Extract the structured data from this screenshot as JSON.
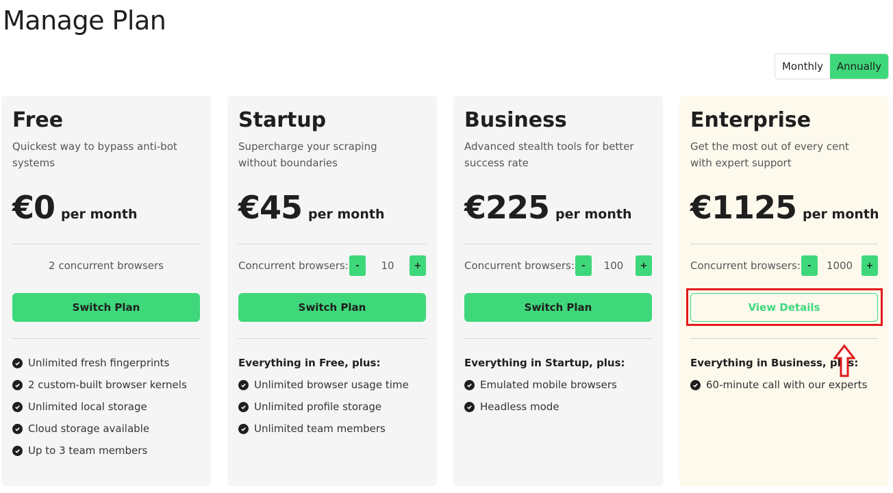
{
  "page": {
    "title": "Manage Plan"
  },
  "billing": {
    "monthly_label": "Monthly",
    "annually_label": "Annually",
    "selected": "Annually"
  },
  "colors": {
    "accent": "#3ed87b",
    "card_bg": "#f5f5f5",
    "enterprise_bg": "#fdf9ed",
    "highlight": "#e01b1b"
  },
  "plans": [
    {
      "name": "Free",
      "description": "Quickest way to bypass anti-bot systems",
      "price": "€0",
      "period": "per month",
      "browsers_text": "2 concurrent browsers",
      "button_label": "Switch Plan",
      "features_heading": "",
      "features": [
        "Unlimited fresh fingerprints",
        "2 custom-built browser kernels",
        "Unlimited local storage",
        "Cloud storage available",
        "Up to 3 team members"
      ]
    },
    {
      "name": "Startup",
      "description": "Supercharge your scraping without boundaries",
      "price": "€45",
      "period": "per month",
      "browsers_label": "Concurrent browsers:",
      "browsers_value": "10",
      "button_label": "Switch Plan",
      "features_heading": "Everything in Free, plus:",
      "features": [
        "Unlimited browser usage time",
        "Unlimited profile storage",
        "Unlimited team members"
      ]
    },
    {
      "name": "Business",
      "description": "Advanced stealth tools for better success rate",
      "price": "€225",
      "period": "per month",
      "browsers_label": "Concurrent browsers:",
      "browsers_value": "100",
      "button_label": "Switch Plan",
      "features_heading": "Everything in Startup, plus:",
      "features": [
        "Emulated mobile browsers",
        "Headless mode"
      ]
    },
    {
      "name": "Enterprise",
      "description": "Get the most out of every cent with expert support",
      "price": "€1125",
      "period": "per month",
      "browsers_label": "Concurrent browsers:",
      "browsers_value": "1000",
      "button_label": "View Details",
      "features_heading": "Everything in Business, plus:",
      "features": [
        "60-minute call with our experts"
      ]
    }
  ],
  "stepper": {
    "minus": "-",
    "plus": "+"
  },
  "icons": {
    "check": "check-circle-icon",
    "annotation_arrow": "arrow-up-icon"
  }
}
